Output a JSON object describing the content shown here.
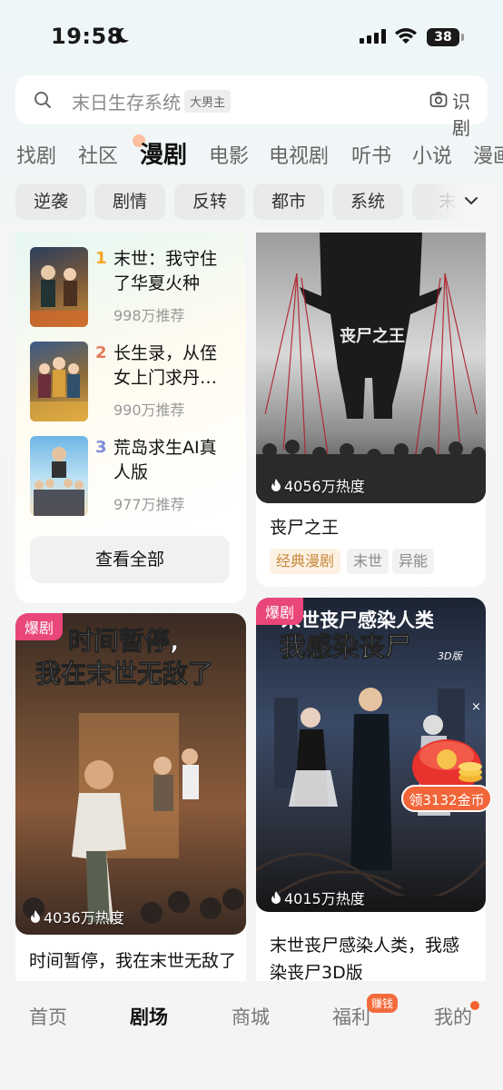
{
  "status_bar": {
    "time": "19:58",
    "battery": "38"
  },
  "search": {
    "placeholder": "末日生存系统",
    "tag": "大男主",
    "scan_label": "识剧"
  },
  "tabs": [
    "找剧",
    "社区",
    "漫剧",
    "电影",
    "电视剧",
    "听书",
    "小说",
    "漫画"
  ],
  "active_tab": "漫剧",
  "chips": [
    "逆袭",
    "剧情",
    "反转",
    "都市",
    "系统",
    "末"
  ],
  "ranking": {
    "items": [
      {
        "rank": "1",
        "title": "末世：我守住了华夏火种",
        "count": "998万推荐",
        "rank_color": "#f5a623"
      },
      {
        "rank": "2",
        "title": "长生录，从侄女上门求丹…",
        "count": "990万推荐",
        "rank_color": "#e77a5b"
      },
      {
        "rank": "3",
        "title": "荒岛求生AI真人版",
        "count": "977万推荐",
        "rank_color": "#7f8bd8"
      }
    ],
    "see_all": "查看全部"
  },
  "cards": {
    "zombie_king": {
      "poster_text": "丧尸之王",
      "heat": "4056万热度",
      "title": "丧尸之王",
      "tags": [
        "经典漫剧",
        "末世",
        "异能"
      ]
    },
    "time_stop": {
      "badge": "爆剧",
      "poster_line1": "时间暂停,",
      "poster_line2": "我在末世无敌了",
      "heat": "4036万热度",
      "title": "时间暂停，我在末世无敌了"
    },
    "zombie_infect": {
      "badge": "爆剧",
      "poster_line1": "末世丧尸感染人类",
      "poster_line2": "我感染丧尸",
      "poster_small": "3D版",
      "heat": "4015万热度",
      "title_line1": "末世丧尸感染人类，我感",
      "title_line2": "染丧尸3D版"
    }
  },
  "coin_float": {
    "label": "领3132金币",
    "close": "×"
  },
  "bottom_nav": [
    {
      "label": "首页",
      "active": false
    },
    {
      "label": "剧场",
      "active": true
    },
    {
      "label": "商城",
      "active": false
    },
    {
      "label": "福利",
      "active": false,
      "badge": "赚钱"
    },
    {
      "label": "我的",
      "active": false
    }
  ]
}
